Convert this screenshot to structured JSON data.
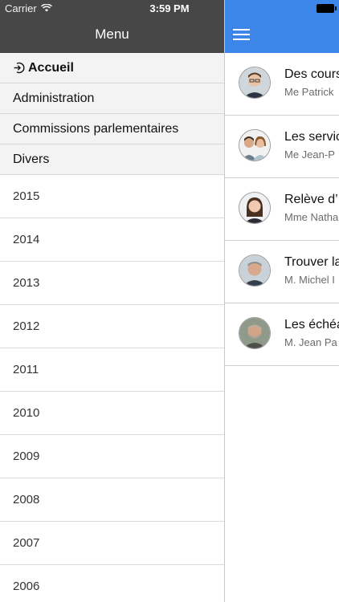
{
  "status_bar": {
    "carrier": "Carrier",
    "time": "3:59 PM"
  },
  "menu": {
    "title": "Menu",
    "sections": [
      {
        "label": "Accueil",
        "icon": "login-arrow-icon"
      },
      {
        "label": "Administration"
      },
      {
        "label": "Commissions parlementaires"
      },
      {
        "label": "Divers"
      }
    ],
    "years": [
      "2015",
      "2014",
      "2013",
      "2012",
      "2011",
      "2010",
      "2009",
      "2008",
      "2007",
      "2006"
    ]
  },
  "main": {
    "nav_icon": "hamburger-menu-icon",
    "accent_color": "#3c86ea",
    "items": [
      {
        "title": "Des cours",
        "author": "Me Patrick"
      },
      {
        "title": "Les servic",
        "author": "Me Jean-P"
      },
      {
        "title": "Relève d’",
        "author": "Mme Natha"
      },
      {
        "title": "Trouver la",
        "author": "M. Michel I"
      },
      {
        "title": "Les échéa",
        "author": "M. Jean Pa"
      }
    ]
  }
}
